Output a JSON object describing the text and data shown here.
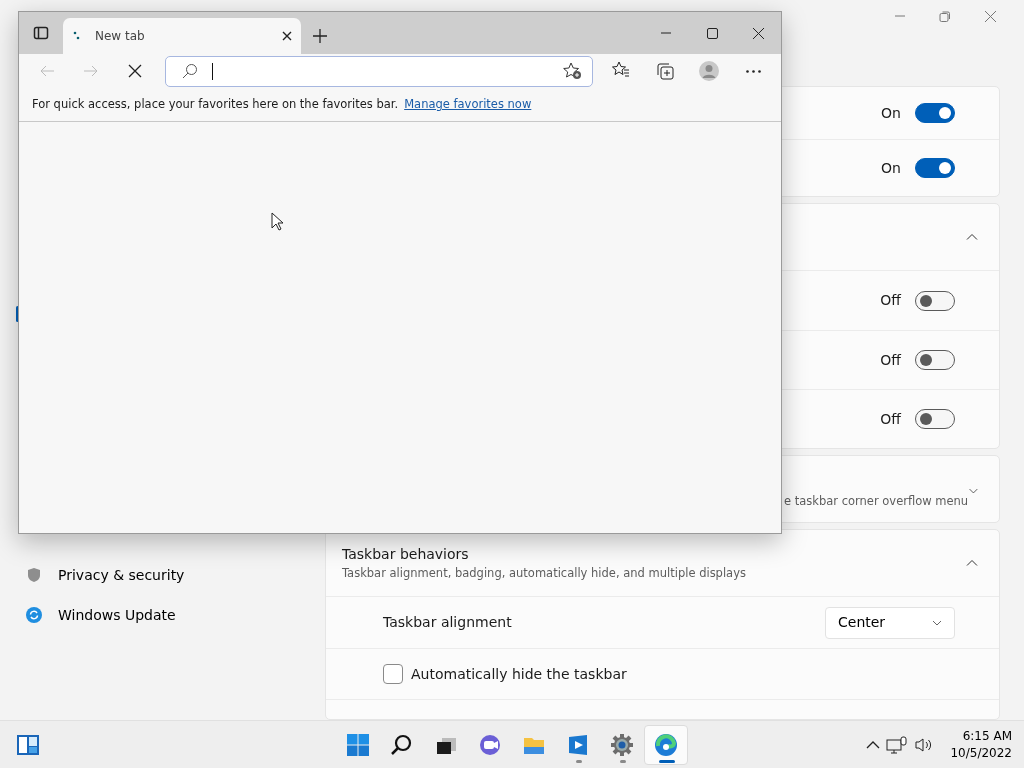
{
  "settings_window": {
    "nav": [
      {
        "label": "Privacy & security",
        "kind": "privacy"
      },
      {
        "label": "Windows Update",
        "kind": "update"
      }
    ],
    "cards": [
      {
        "rows": [
          {
            "value": "On",
            "on": true
          },
          {
            "value": "On",
            "on": true
          }
        ]
      },
      {
        "expanded": true,
        "rows": [
          {
            "value": "Off",
            "on": false
          },
          {
            "value": "Off",
            "on": false
          },
          {
            "value": "Off",
            "on": false
          }
        ]
      },
      {
        "expanded": false,
        "subtitle": "e taskbar corner overflow menu"
      },
      {
        "title": "Taskbar behaviors",
        "subtitle": "Taskbar alignment, badging, automatically hide, and multiple displays",
        "expanded": true,
        "settings": [
          {
            "kind": "dropdown",
            "label": "Taskbar alignment",
            "value": "Center"
          },
          {
            "kind": "checkbox",
            "label": "Automatically hide the taskbar",
            "checked": false
          }
        ]
      }
    ]
  },
  "browser_window": {
    "tab": {
      "title": "New tab"
    },
    "favorites_bar": {
      "message": "For quick access, place your favorites here on the favorites bar.",
      "link": "Manage favorites now"
    }
  },
  "taskbar": {
    "apps": [
      {
        "kind": "start",
        "running": false,
        "selected": false
      },
      {
        "kind": "search",
        "running": false,
        "selected": false
      },
      {
        "kind": "taskview",
        "running": false,
        "selected": false
      },
      {
        "kind": "chat",
        "running": false,
        "selected": false
      },
      {
        "kind": "explorer",
        "running": false,
        "selected": false
      },
      {
        "kind": "media",
        "running": true,
        "selected": false
      },
      {
        "kind": "settings",
        "running": true,
        "selected": false
      },
      {
        "kind": "edge",
        "running": true,
        "selected": true
      }
    ],
    "time": "6:15 AM",
    "date": "10/5/2022"
  }
}
